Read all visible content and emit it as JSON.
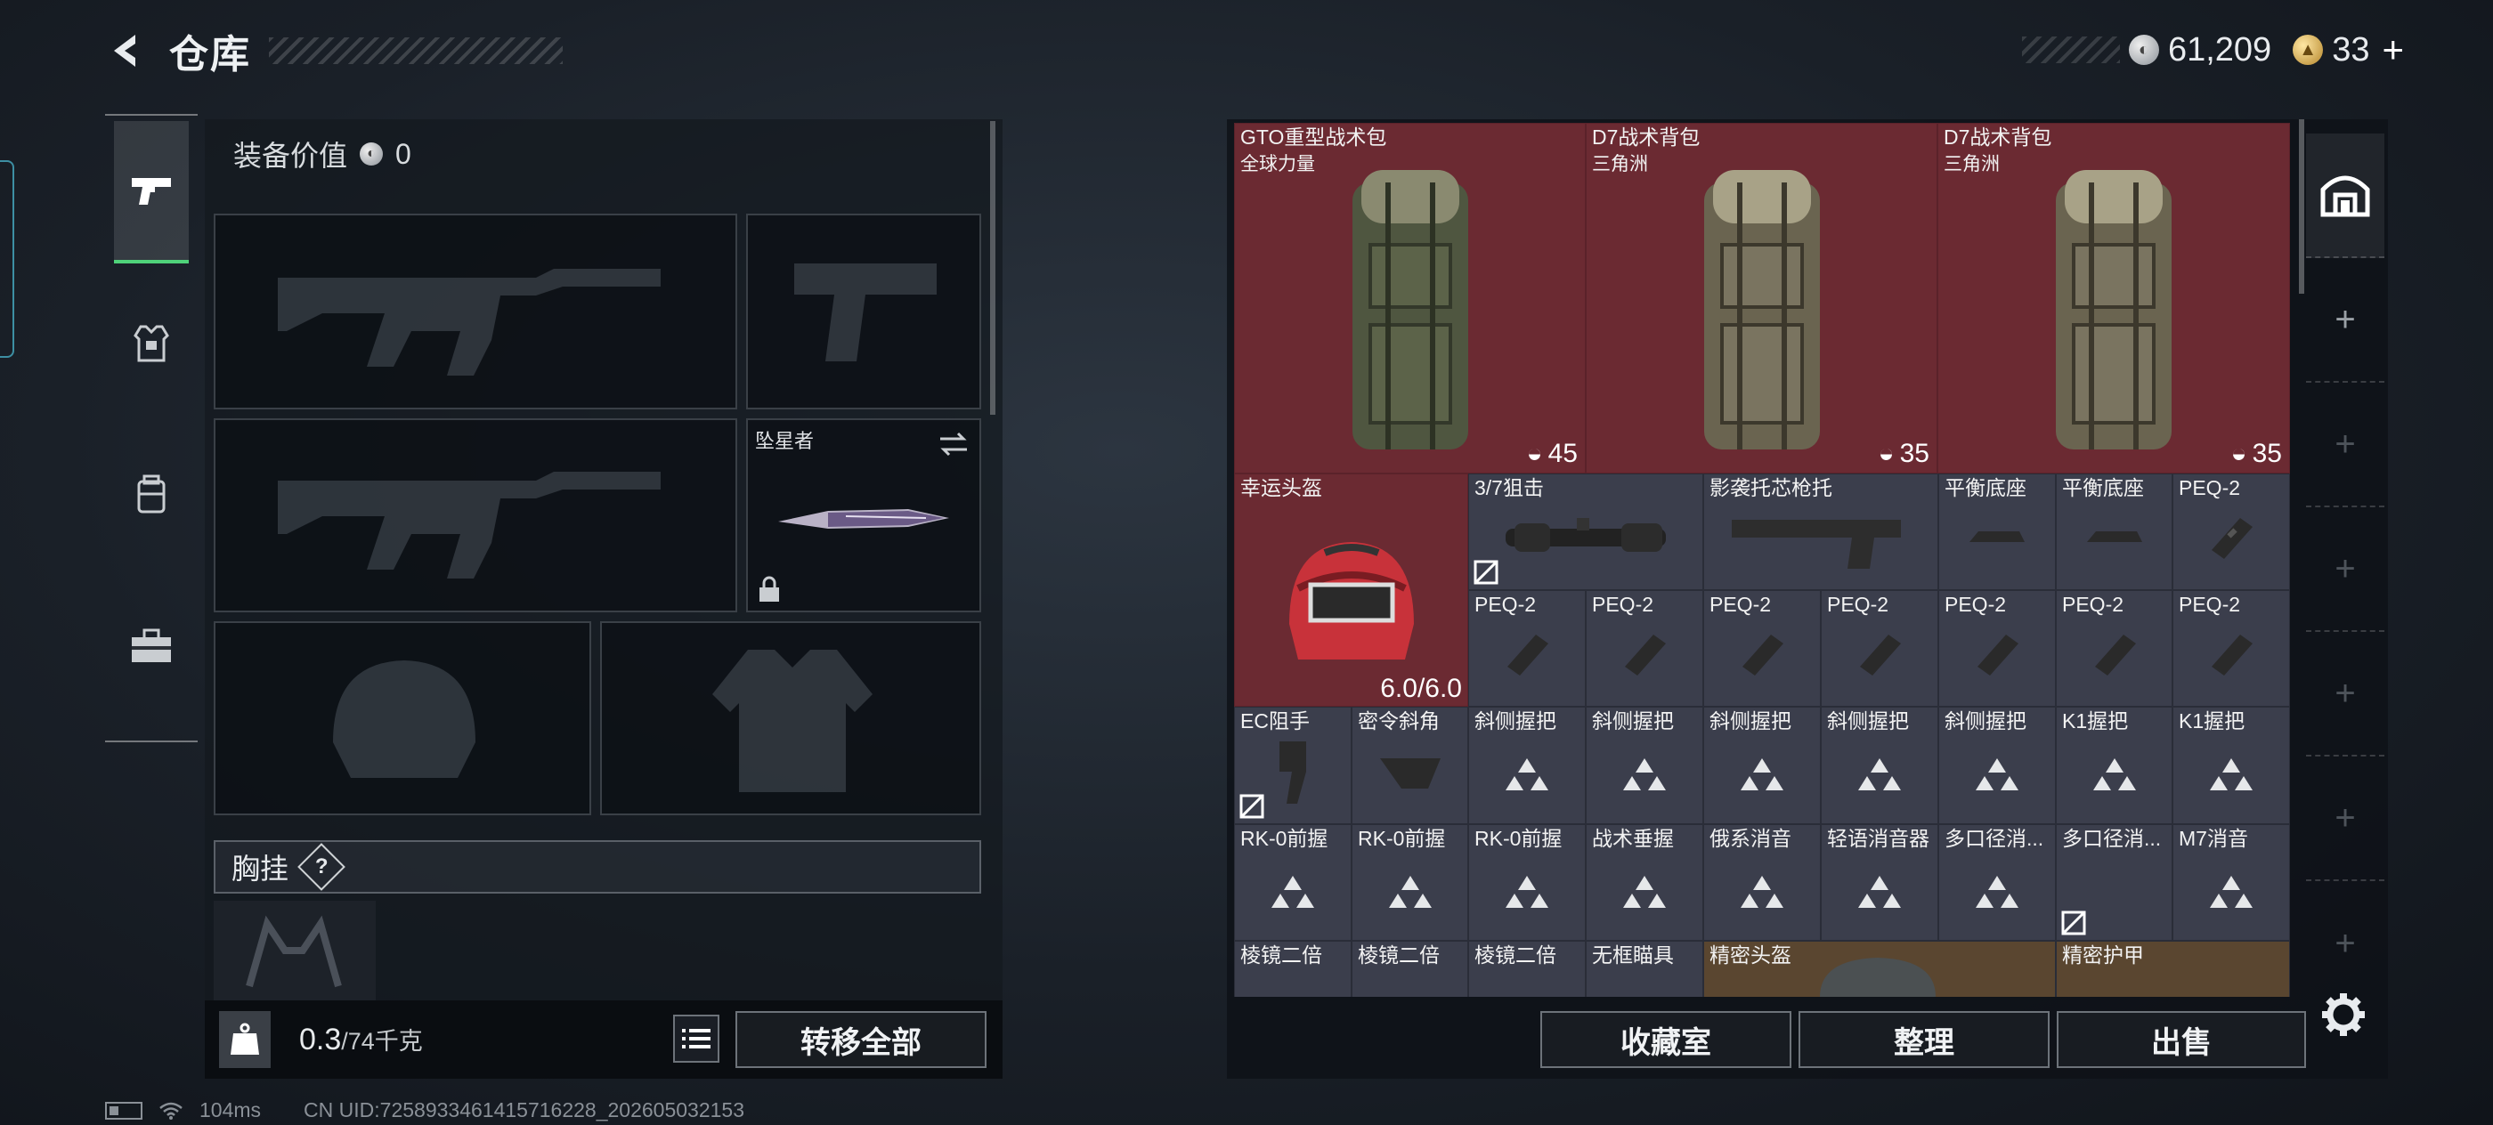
{
  "header": {
    "title": "仓库",
    "back_icon": "back-arrow-icon"
  },
  "currency": {
    "silver_amount": "61,209",
    "gold_amount": "33",
    "plus_label": "+"
  },
  "left_tabs": [
    {
      "icon": "pistol-icon",
      "active": true
    },
    {
      "icon": "armor-vest-icon",
      "active": false
    },
    {
      "icon": "backpack-icon",
      "active": false
    },
    {
      "icon": "toolbox-icon",
      "active": false
    }
  ],
  "loadout": {
    "equipment_value_label": "装备价值",
    "equipment_value": "0",
    "melee_label": "坠星者",
    "chest_label": "胸挂",
    "help_label": "?"
  },
  "footer_left": {
    "kg_label": "KG",
    "weight_current": "0.3",
    "weight_max": "/74千克",
    "transfer_all": "转移全部"
  },
  "status": {
    "ping": "104ms",
    "uid": "CN UID:7258933461415716228_202605032153"
  },
  "stash": {
    "backpacks": [
      {
        "name": "GTO重型战术包",
        "sub": "全球力量",
        "count": "45"
      },
      {
        "name": "D7战术背包",
        "sub": "三角洲",
        "count": "35"
      },
      {
        "name": "D7战术背包",
        "sub": "三角洲",
        "count": "35"
      }
    ],
    "helmet": {
      "name": "幸运头盔",
      "durability": "6.0/6.0"
    },
    "row2": [
      "3/7狙击",
      "影袭托芯枪托",
      "平衡底座",
      "平衡底座",
      "PEQ-2"
    ],
    "row3": [
      "PEQ-2",
      "PEQ-2",
      "PEQ-2",
      "PEQ-2",
      "PEQ-2",
      "PEQ-2",
      "PEQ-2"
    ],
    "row4": [
      "EC阻手",
      "密令斜角",
      "斜侧握把",
      "斜侧握把",
      "斜侧握把",
      "斜侧握把",
      "斜侧握把",
      "K1握把",
      "K1握把"
    ],
    "row5": [
      "RK-0前握",
      "RK-0前握",
      "RK-0前握",
      "战术垂握",
      "俄系消音",
      "轻语消音器",
      "多口径消...",
      "多口径消...",
      "M7消音"
    ],
    "row6": [
      "棱镜二倍",
      "棱镜二倍",
      "棱镜二倍",
      "无框瞄具",
      "精密头盔",
      "精密护甲"
    ]
  },
  "footer_right": {
    "collection": "收藏室",
    "sort": "整理",
    "sell": "出售"
  },
  "side_tabs": [
    "bunker-icon",
    "plus-icon",
    "plus-icon",
    "plus-icon",
    "plus-icon",
    "plus-icon",
    "plus-icon"
  ]
}
